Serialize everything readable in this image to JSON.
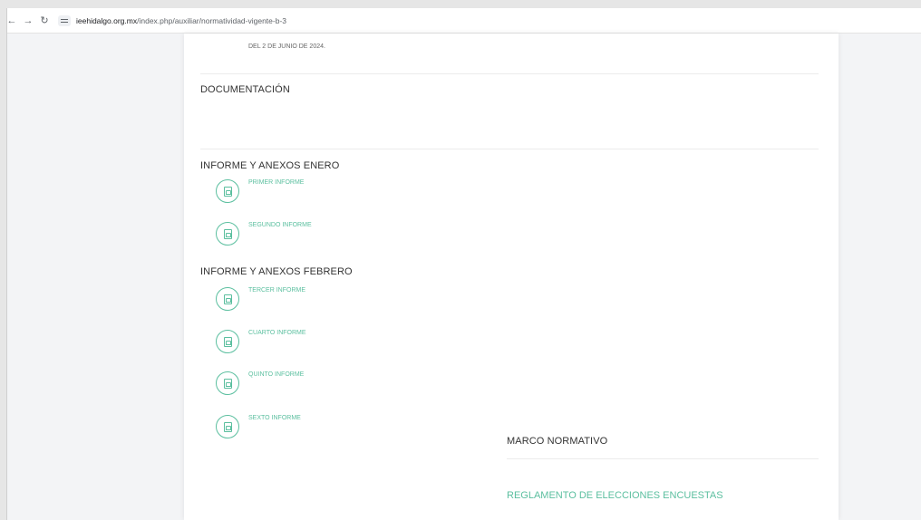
{
  "browser": {
    "back_icon": "arrow-left-icon",
    "forward_icon": "arrow-right-icon",
    "reload_icon": "reload-icon",
    "site_info_icon": "site-info-icon",
    "url_domain": "ieehidalgo.org.mx",
    "url_path": "/index.php/auxiliar/normatividad-vigente-b-3"
  },
  "content": {
    "date_line": "DEL 2 DE JUNIO DE 2024.",
    "documentacion_heading": "DOCUMENTACIÓN",
    "enero_heading": "INFORME Y ANEXOS ENERO",
    "febrero_heading": "INFORME Y ANEXOS FEBRERO",
    "enero_items": [
      {
        "label": "PRIMER INFORME",
        "icon": "pdf-file-icon"
      },
      {
        "label": "SEGUNDO INFORME",
        "icon": "pdf-file-icon"
      }
    ],
    "febrero_items": [
      {
        "label": "TERCER INFORME",
        "icon": "pdf-file-icon"
      },
      {
        "label": "CUARTO INFORME",
        "icon": "pdf-file-icon"
      },
      {
        "label": "QUINTO INFORME",
        "icon": "pdf-file-icon"
      },
      {
        "label": "SEXTO INFORME",
        "icon": "pdf-file-icon"
      }
    ],
    "marco_heading": "MARCO NORMATIVO",
    "marco_link": "REGLAMENTO DE ELECCIONES ENCUESTAS"
  },
  "colors": {
    "accent": "#5bbf9f",
    "heading_text": "#333333",
    "page_bg": "#ffffff",
    "outer_bg": "#f3f4f6"
  }
}
